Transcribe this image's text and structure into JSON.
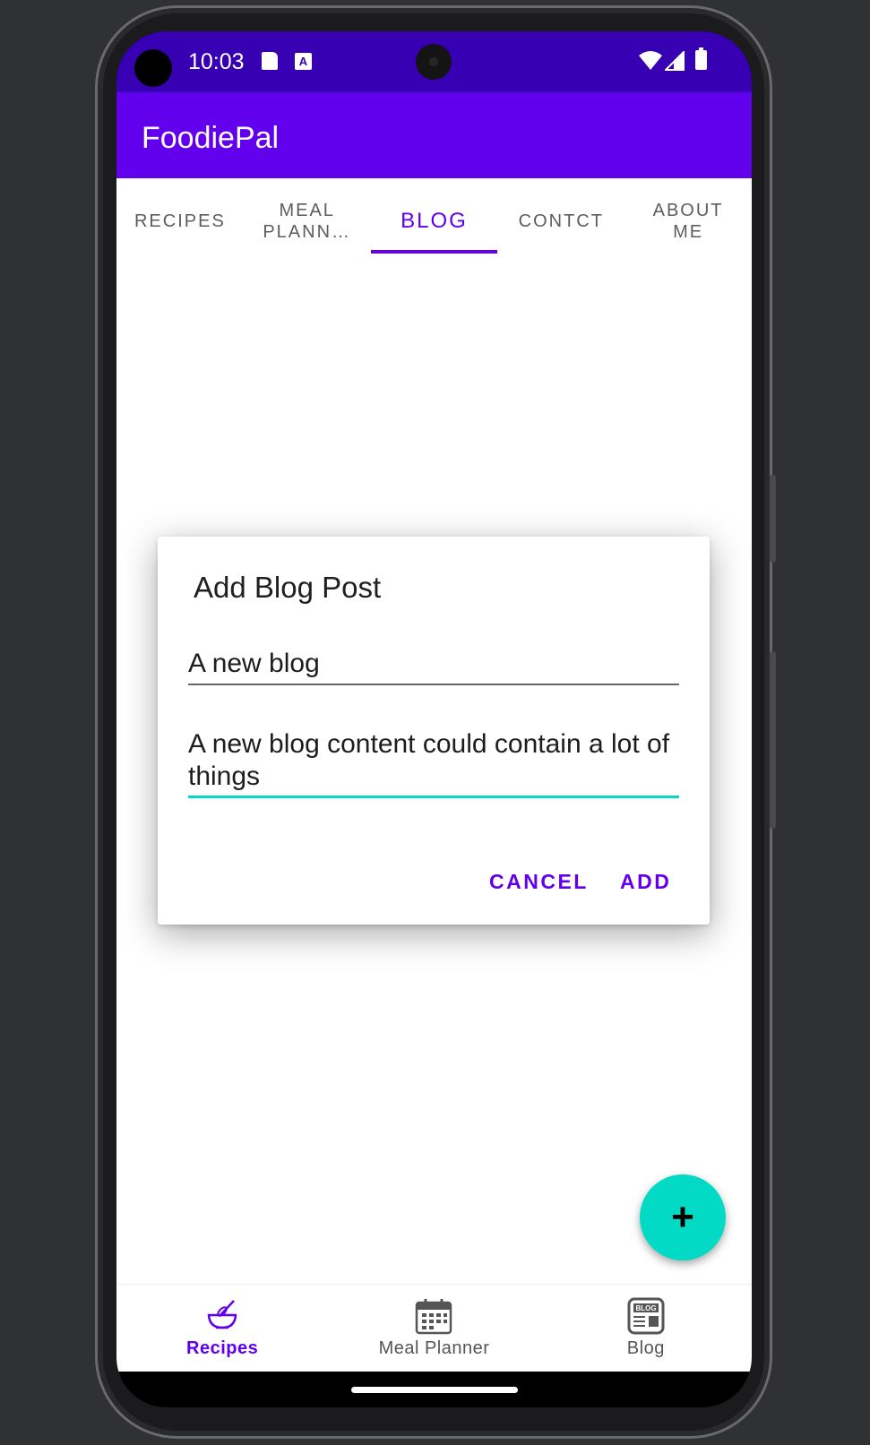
{
  "status_bar": {
    "time": "10:03",
    "a_badge": "A"
  },
  "app_bar": {
    "title": "FoodiePal"
  },
  "tabs": [
    {
      "label": "RECIPES"
    },
    {
      "label": "MEAL PLANN…"
    },
    {
      "label": "BLOG"
    },
    {
      "label": "CONTCT"
    },
    {
      "label": "ABOUT ME"
    }
  ],
  "active_tab": "BLOG",
  "dialog": {
    "title": "Add Blog Post",
    "title_field_value": "A new blog",
    "content_field_value": "A new blog content could contain a lot of things",
    "cancel_label": "CANCEL",
    "add_label": "ADD"
  },
  "fab": {
    "label": "+"
  },
  "bottom_nav": [
    {
      "label": "Recipes",
      "icon": "whisk-bowl-icon"
    },
    {
      "label": "Meal Planner",
      "icon": "calendar-icon"
    },
    {
      "label": "Blog",
      "icon": "blog-icon"
    }
  ],
  "blog_icon_text": "BLOG",
  "colors": {
    "primary": "#6200ee",
    "primary_dark": "#3700b3",
    "secondary": "#03dac5"
  }
}
